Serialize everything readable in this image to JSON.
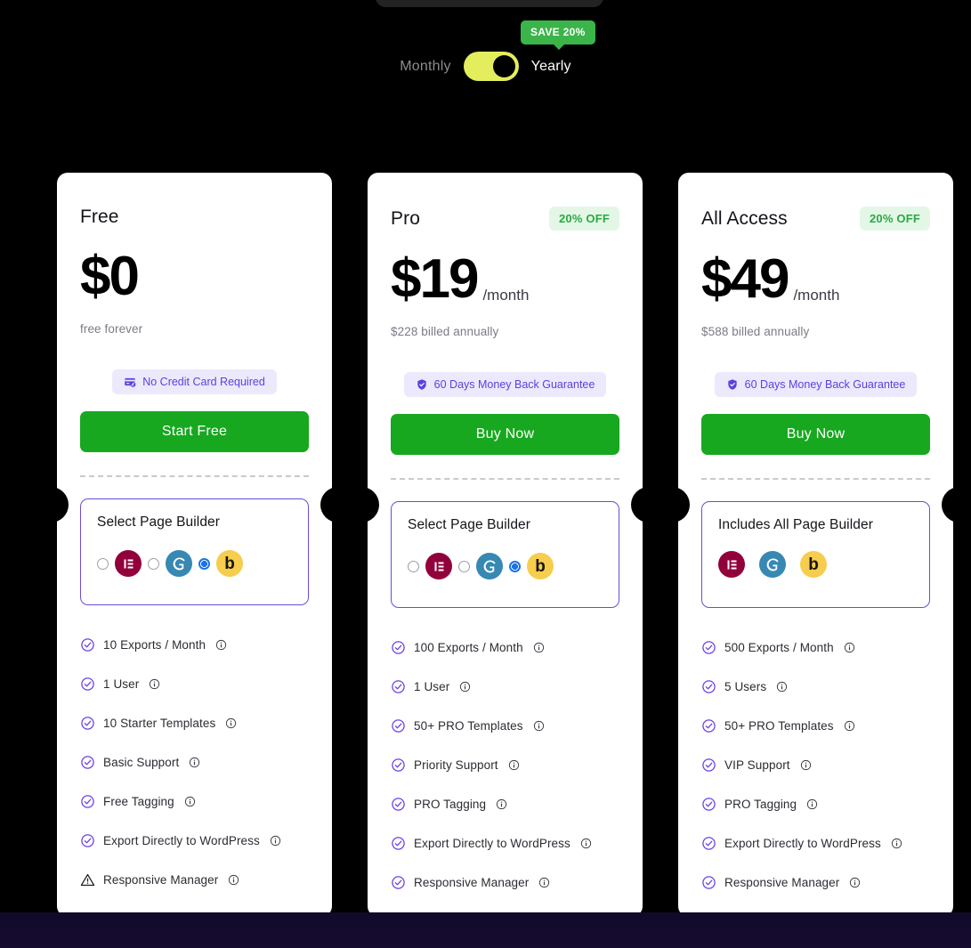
{
  "billing": {
    "monthly_label": "Monthly",
    "yearly_label": "Yearly",
    "selected": "Yearly",
    "save_badge": "SAVE 20%",
    "toggle_color": "#e4ed5c",
    "save_badge_color": "#3bb44a"
  },
  "plans": [
    {
      "name": "Free",
      "discount_badge": "",
      "price": "$0",
      "period": "",
      "billed_note": "free forever",
      "trust_badge": "No Credit Card Required",
      "trust_icon": "credit-card-off-icon",
      "cta_label": "Start Free",
      "builder_title": "Select Page Builder",
      "builder_selectable": true,
      "builders": [
        {
          "name": "elementor",
          "label": "Elementor",
          "color": "#92003b",
          "selected": false
        },
        {
          "name": "gutenberg",
          "label": "Gutenberg",
          "color": "#3788b3",
          "selected": false
        },
        {
          "name": "beaver",
          "label": "Beaver Builder",
          "color": "#f6cd4c",
          "selected": true
        }
      ],
      "features": [
        {
          "text": "10 Exports / Month",
          "icon": "check-circle-icon"
        },
        {
          "text": "1 User",
          "icon": "check-circle-icon"
        },
        {
          "text": "10 Starter Templates",
          "icon": "check-circle-icon"
        },
        {
          "text": "Basic Support",
          "icon": "check-circle-icon"
        },
        {
          "text": "Free Tagging",
          "icon": "check-circle-icon"
        },
        {
          "text": "Export Directly to WordPress",
          "icon": "check-circle-icon"
        },
        {
          "text": "Responsive Manager",
          "icon": "warning-triangle-icon"
        }
      ]
    },
    {
      "name": "Pro",
      "discount_badge": "20% OFF",
      "price": "$19",
      "period": "/month",
      "billed_note": "$228 billed annually",
      "trust_badge": "60 Days Money Back Guarantee",
      "trust_icon": "shield-check-icon",
      "cta_label": "Buy Now",
      "builder_title": "Select Page Builder",
      "builder_selectable": true,
      "builders": [
        {
          "name": "elementor",
          "label": "Elementor",
          "color": "#92003b",
          "selected": false
        },
        {
          "name": "gutenberg",
          "label": "Gutenberg",
          "color": "#3788b3",
          "selected": false
        },
        {
          "name": "beaver",
          "label": "Beaver Builder",
          "color": "#f6cd4c",
          "selected": true
        }
      ],
      "features": [
        {
          "text": "100 Exports / Month",
          "icon": "check-circle-icon"
        },
        {
          "text": "1 User",
          "icon": "check-circle-icon"
        },
        {
          "text": "50+ PRO Templates",
          "icon": "check-circle-icon"
        },
        {
          "text": "Priority Support",
          "icon": "check-circle-icon"
        },
        {
          "text": "PRO Tagging",
          "icon": "check-circle-icon"
        },
        {
          "text": "Export Directly to WordPress",
          "icon": "check-circle-icon"
        },
        {
          "text": "Responsive Manager",
          "icon": "check-circle-icon"
        }
      ]
    },
    {
      "name": "All Access",
      "discount_badge": "20% OFF",
      "price": "$49",
      "period": "/month",
      "billed_note": "$588 billed annually",
      "trust_badge": "60 Days Money Back Guarantee",
      "trust_icon": "shield-check-icon",
      "cta_label": "Buy Now",
      "builder_title": "Includes All Page Builder",
      "builder_selectable": false,
      "builders": [
        {
          "name": "elementor",
          "label": "Elementor",
          "color": "#92003b",
          "selected": false
        },
        {
          "name": "gutenberg",
          "label": "Gutenberg",
          "color": "#3788b3",
          "selected": false
        },
        {
          "name": "beaver",
          "label": "Beaver Builder",
          "color": "#f6cd4c",
          "selected": false
        }
      ],
      "features": [
        {
          "text": "500 Exports / Month",
          "icon": "check-circle-icon"
        },
        {
          "text": "5 Users",
          "icon": "check-circle-icon"
        },
        {
          "text": "50+ PRO Templates",
          "icon": "check-circle-icon"
        },
        {
          "text": "VIP Support",
          "icon": "check-circle-icon"
        },
        {
          "text": "PRO Tagging",
          "icon": "check-circle-icon"
        },
        {
          "text": "Export Directly to WordPress",
          "icon": "check-circle-icon"
        },
        {
          "text": "Responsive Manager",
          "icon": "check-circle-icon"
        }
      ]
    }
  ],
  "colors": {
    "cta_green": "#17a81f",
    "badge_green_bg": "#e4f7e6",
    "badge_green_text": "#2aa845",
    "trust_purple_bg": "#ece9fd",
    "trust_purple_text": "#5b41e0",
    "check_purple": "#6b3fe4",
    "builder_border": "#6b4bd8",
    "radio_selected": "#1a73e8"
  }
}
